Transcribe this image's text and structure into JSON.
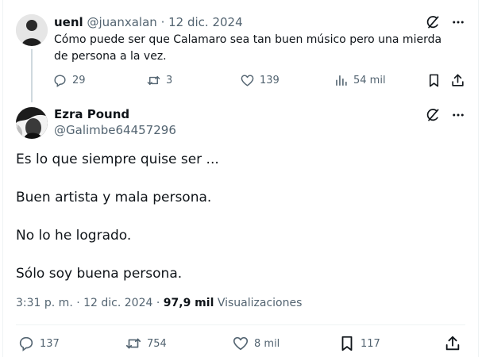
{
  "parent_tweet": {
    "display_name": "uenl",
    "handle": "@juanxalan",
    "separator": "·",
    "date": "12 dic. 2024",
    "text": "Cómo puede ser que Calamaro sea tan buen músico pero una mierda de persona a la vez.",
    "replies": "29",
    "retweets": "3",
    "likes": "139",
    "views": "54 mil"
  },
  "main_tweet": {
    "display_name": "Ezra Pound",
    "handle": "@Galimbe64457296",
    "lines": [
      "Es lo que siempre quise ser ...",
      "Buen artista y mala persona.",
      "No lo he logrado.",
      "Sólo soy buena persona."
    ],
    "time": "3:31 p. m.",
    "separator": "·",
    "date": "12 dic. 2024",
    "views_count": "97,9 mil",
    "views_label": "Visualizaciones",
    "replies": "137",
    "retweets": "754",
    "likes": "8 mil",
    "bookmarks": "117"
  },
  "icons": {
    "grok": "grok-icon",
    "more": "more-icon",
    "reply": "reply-icon",
    "retweet": "retweet-icon",
    "like": "heart-icon",
    "views": "views-icon",
    "bookmark": "bookmark-icon",
    "share": "share-icon"
  },
  "colors": {
    "text": "#0f1419",
    "muted": "#536471",
    "line": "#cfd9de",
    "divider": "#eff3f4"
  }
}
